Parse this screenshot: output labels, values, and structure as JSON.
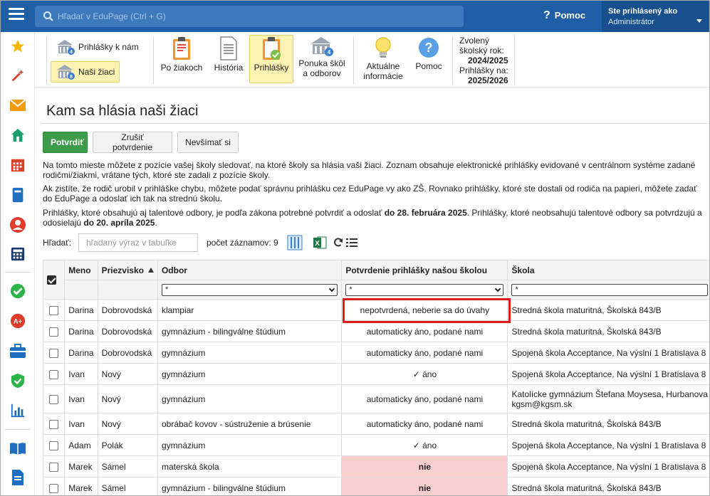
{
  "topbar": {
    "search_placeholder": "Hľadať v EduPage (Ctrl + G)",
    "help_label": "Pomoc",
    "user_line1": "Ste prihlásený ako",
    "user_line2": "Administrátor"
  },
  "leftnav": {
    "icons": [
      "star-icon",
      "magic-wand-icon",
      "envelope-icon",
      "home-icon",
      "calendar-icon",
      "book-icon",
      "person-circle-icon",
      "calculator-icon",
      "check-circle-icon",
      "a-plus-icon",
      "briefcase-icon",
      "shield-check-icon",
      "bar-chart-icon",
      "open-book-icon",
      "document-icon"
    ]
  },
  "ribbon": {
    "prihlasky_k_nam": "Prihlášky k nám",
    "nasi_ziaci": "Naši žiaci",
    "po_ziakoch": "Po žiakoch",
    "historia": "História",
    "prihlasky": "Prihlášky",
    "ponuka_line1": "Ponuka škôl",
    "ponuka_line2": "a odborov",
    "aktualne_line1": "Aktuálne",
    "aktualne_line2": "informácie",
    "pomoc": "Pomoc",
    "year_line1": "Zvolený",
    "year_line2": "školský rok:",
    "year_value": "2024/2025",
    "apps_line": "Prihlášky na:",
    "apps_value": "2025/2026"
  },
  "page": {
    "title": "Kam sa hlásia naši žiaci",
    "btn_confirm": "Potvrdiť",
    "btn_unconfirm": "Zrušiť potvrdenie",
    "btn_ignore": "Nevšímať si",
    "para1_line1": "Na tomto mieste môžete z pozície vašej školy sledovať, na ktoré školy sa hlásia vaši žiaci. Zoznam obsahuje elektronické prihlášky evidované v centrálnom systéme zadané",
    "para1_line2": "rodičmi/žiakmi, vrátane tých, ktoré ste zadali z pozície školy.",
    "para2_line1": "Ak zistíte, že rodič urobil v prihláške chybu, môžete podať správnu prihlášku cez EduPage vy ako ZŠ. Rovnako prihlášky, ktoré ste dostali od rodiča na papieri, môžete zadať",
    "para2_line2": "do EduPage a odoslať ich tak na strednú školu.",
    "para3_part1": "Prihlášky, ktoré obsahujú aj talentové odbory, je podľa zákona potrebné potvrdiť a odoslať ",
    "para3_bold1": "do 28. februára 2025",
    "para3_part2": ". Prihlášky, ktoré neobsahujú talentové odbory sa potvrdzujú a",
    "para3_part3": "odosielajú ",
    "para3_bold2": "do 20. apríla 2025",
    "para3_part4": ".",
    "search_label": "Hľadať:",
    "search_placeholder": "hľadaný výraz v tabuľke",
    "count_label": "počet záznamov: 9"
  },
  "table": {
    "headers": {
      "meno": "Meno",
      "priezvisko": "Priezvisko",
      "odbor": "Odbor",
      "potvrdenie": "Potvrdenie prihlášky našou školou",
      "skola": "Škola"
    },
    "filters": {
      "odbor": "*",
      "potvrdenie": "*",
      "skola": "*"
    },
    "rows": [
      {
        "meno": "Darina",
        "priezvisko": "Dobrovodská",
        "odbor": "klampiar",
        "potvrdenie": "nepotvrdená, neberie sa do úvahy",
        "skola": "Stredná škola maturitná, Školská 843/B",
        "skola2": ""
      },
      {
        "meno": "Darina",
        "priezvisko": "Dobrovodská",
        "odbor": "gymnázium - bilingválne štúdium",
        "potvrdenie": "automaticky áno, podané nami",
        "skola": "Stredná škola maturitná, Školská 843/B",
        "skola2": ""
      },
      {
        "meno": "Darina",
        "priezvisko": "Dobrovodská",
        "odbor": "gymnázium",
        "potvrdenie": "automaticky áno, podané nami",
        "skola": "Spojená škola Acceptance, Na výslní 1 Bratislava 8",
        "skola2": ""
      },
      {
        "meno": "Ivan",
        "priezvisko": "Nový",
        "odbor": "gymnázium",
        "potvrdenie": "✓ áno",
        "skola": "Spojená škola Acceptance, Na výslní 1 Bratislava 8",
        "skola2": ""
      },
      {
        "meno": "Ivan",
        "priezvisko": "Nový",
        "odbor": "gymnázium",
        "potvrdenie": "automaticky áno, podané nami",
        "skola": "Katolícke gymnázium Štefana Moysesa, Hurbanova",
        "skola2": "kgsm@kgsm.sk"
      },
      {
        "meno": "Ivan",
        "priezvisko": "Nový",
        "odbor": "obrábač kovov - sústruženie a brúsenie",
        "potvrdenie": "automaticky áno, podané nami",
        "skola": "Stredná škola maturitná, Školská 843/B",
        "skola2": ""
      },
      {
        "meno": "Adam",
        "priezvisko": "Polák",
        "odbor": "gymnázium",
        "potvrdenie": "✓ áno",
        "skola": "Spojená škola Acceptance, Na výslní 1 Bratislava 8",
        "skola2": ""
      },
      {
        "meno": "Marek",
        "priezvisko": "Sámel",
        "odbor": "materská škola",
        "potvrdenie": "nie",
        "skola": "Spojená škola Acceptance, Na výslní 1 Bratislava 8",
        "skola2": ""
      },
      {
        "meno": "Marek",
        "priezvisko": "Sámel",
        "odbor": "gymnázium - bilingválne štúdium",
        "potvrdenie": "nie",
        "skola": "Stredná škola maturitná, Školská 843/B",
        "skola2": ""
      }
    ]
  },
  "colors": {
    "topbar": "#1e5fa8",
    "accent_green": "#3c9c4b",
    "highlight_yellow": "#fff3b3",
    "negative_row": "#f8cfcf",
    "annotation_red": "#e01b1b"
  }
}
